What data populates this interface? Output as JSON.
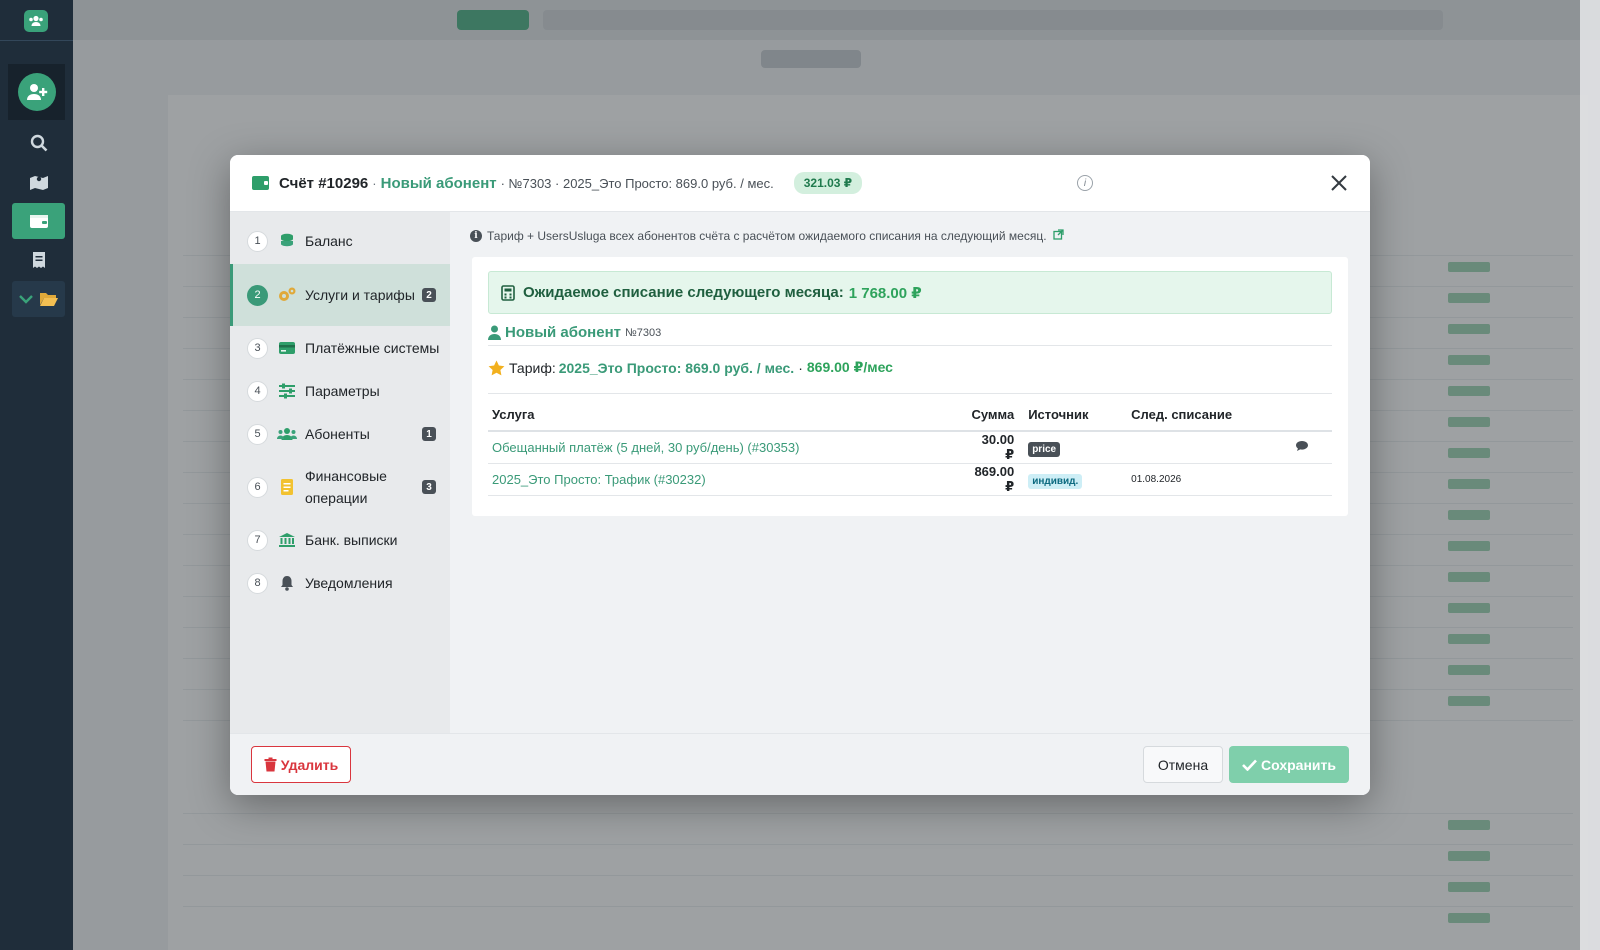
{
  "app": {
    "colors": {
      "accent": "#3a9a78",
      "success": "#2ea35c",
      "danger": "#d9363e",
      "sidebar": "#1f2d3a"
    },
    "sidebar_icons": [
      "users-logo-icon",
      "add-user-icon",
      "search-icon",
      "map-icon",
      "wallet-icon",
      "receipt-icon",
      "folder-open-icon"
    ]
  },
  "modal": {
    "title": "Счёт #10296",
    "subscriber_name": "Новый абонент",
    "meta": "· №7303 · 2025_Это Просто: 869.0 руб. / мес.",
    "balance_badge": "321.03 ₽",
    "info_icon": "info-icon",
    "close_icon": "close-icon"
  },
  "nav": {
    "items": [
      {
        "step": "1",
        "label": "Баланс",
        "icon": "coins-icon",
        "count": ""
      },
      {
        "step": "2",
        "label": "Услуги и тарифы",
        "icon": "gears-icon",
        "count": "2"
      },
      {
        "step": "3",
        "label": "Платёжные системы",
        "icon": "credit-card-icon",
        "count": ""
      },
      {
        "step": "4",
        "label": "Параметры",
        "icon": "sliders-icon",
        "count": ""
      },
      {
        "step": "5",
        "label": "Абоненты",
        "icon": "users-icon",
        "count": "1"
      },
      {
        "step": "6",
        "label": "Финансовые операции",
        "icon": "document-icon",
        "count": "3"
      },
      {
        "step": "7",
        "label": "Банк. выписки",
        "icon": "bank-icon",
        "count": ""
      },
      {
        "step": "8",
        "label": "Уведомления",
        "icon": "bell-icon",
        "count": ""
      }
    ]
  },
  "content": {
    "hint": "Тариф + UsersUsluga всех абонентов счёта с расчётом ожидаемого списания на следующий месяц.",
    "expected_label": "Ожидаемое списание следующего месяца:",
    "expected_value": "1 768.00 ₽",
    "subscriber_name": "Новый абонент",
    "subscriber_number": "№7303",
    "tariff_label": "Тариф:",
    "tariff_name": "2025_Это Просто: 869.0 руб. / мес.",
    "tariff_sep": "·",
    "tariff_price": "869.00 ₽/мес",
    "table": {
      "headers": {
        "service": "Услуга",
        "sum": "Сумма",
        "source": "Источник",
        "next": "След. списание"
      },
      "rows": [
        {
          "service": "Обещанный платёж (5 дней, 30 руб/день) (#30353)",
          "sum": "30.00 ₽",
          "source": "price",
          "next": "",
          "action": "comment-icon"
        },
        {
          "service": "2025_Это Просто: Трафик (#30232)",
          "sum": "869.00 ₽",
          "source": "индивид.",
          "next": "01.08.2026",
          "action": ""
        }
      ]
    }
  },
  "footer": {
    "delete_label": "Удалить",
    "cancel_label": "Отмена",
    "save_label": "Сохранить"
  }
}
